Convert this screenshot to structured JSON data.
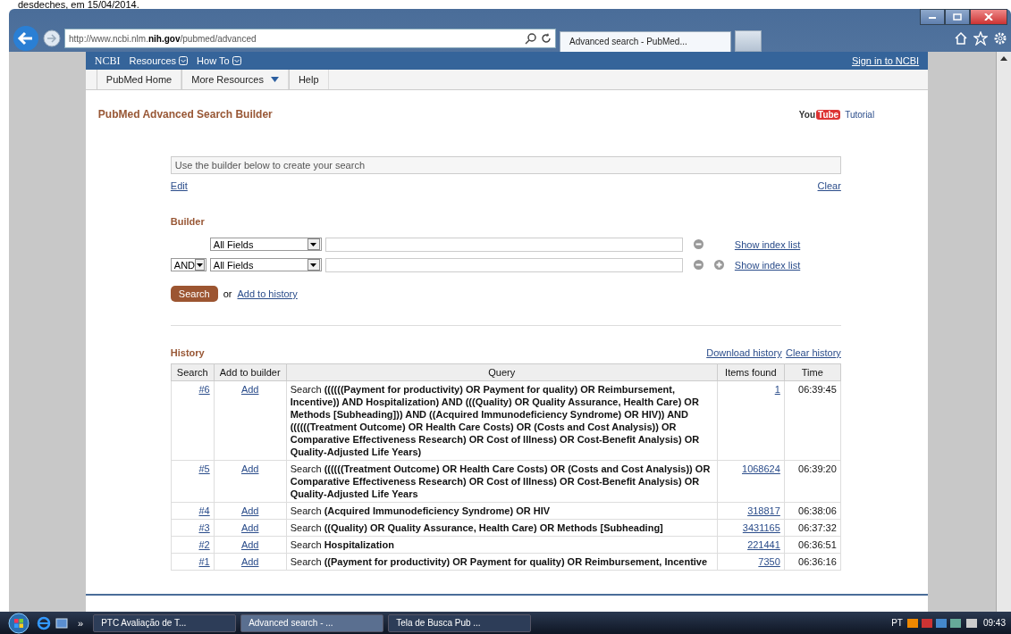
{
  "doc_caption": "desdeches, em 15/04/2014.",
  "browser": {
    "address_prefix": "http://www.ncbi.nlm.",
    "address_host": "nih.gov",
    "address_path": "/pubmed/advanced",
    "tabs": [
      {
        "title": "Advanced search - PubMed..."
      }
    ]
  },
  "ncbi_bar": {
    "logo": "NCBI",
    "menus": [
      "Resources",
      "How To"
    ],
    "sign_in": "Sign in to NCBI"
  },
  "nav": [
    {
      "label": "PubMed Home",
      "dropdown": false
    },
    {
      "label": "More Resources",
      "dropdown": true
    },
    {
      "label": "Help",
      "dropdown": false
    }
  ],
  "title": "PubMed Advanced Search Builder",
  "tutorial": {
    "logo_you": "You",
    "logo_tube": "Tube",
    "label": "Tutorial"
  },
  "search_box": {
    "placeholder": "Use the builder below to create your search"
  },
  "edit": "Edit",
  "clear": "Clear",
  "builder": {
    "heading": "Builder",
    "rows": [
      {
        "field": "All Fields",
        "can_add": false,
        "index_link": "Show index list"
      },
      {
        "operator": "AND",
        "field": "All Fields",
        "can_add": true,
        "index_link": "Show index list"
      }
    ]
  },
  "search_button": "Search",
  "or_text": "or",
  "add_to_history": "Add to history",
  "history": {
    "heading": "History",
    "download": "Download history",
    "clear": "Clear history",
    "columns": [
      "Search",
      "Add to builder",
      "Query",
      "Items found",
      "Time"
    ],
    "rows": [
      {
        "search": "#6",
        "add": "Add",
        "query": "Search **((((((Payment for productivity) OR Payment for quality) OR Reimbursement, Incentive)) AND Hospitalization) AND (((Quality) OR Quality Assurance, Health Care) OR Methods [Subheading])) AND ((Acquired Immunodeficiency Syndrome) OR HIV)) AND ((((((Treatment Outcome) OR Health Care Costs) OR (Costs and Cost Analysis)) OR Comparative Effectiveness Research) OR Cost of Illness) OR Cost-Benefit Analysis) OR Quality-Adjusted Life Years)**",
        "items": "1",
        "time": "06:39:45"
      },
      {
        "search": "#5",
        "add": "Add",
        "query": "Search **((((((Treatment Outcome) OR Health Care Costs) OR (Costs and Cost Analysis)) OR Comparative Effectiveness Research) OR Cost of Illness) OR Cost-Benefit Analysis) OR Quality-Adjusted Life Years**",
        "items": "1068624",
        "time": "06:39:20"
      },
      {
        "search": "#4",
        "add": "Add",
        "query": "Search **(Acquired Immunodeficiency Syndrome) OR HIV**",
        "items": "318817",
        "time": "06:38:06"
      },
      {
        "search": "#3",
        "add": "Add",
        "query": "Search **((Quality) OR Quality Assurance, Health Care) OR Methods [Subheading]**",
        "items": "3431165",
        "time": "06:37:32"
      },
      {
        "search": "#2",
        "add": "Add",
        "query": "Search **Hospitalization**",
        "items": "221441",
        "time": "06:36:51"
      },
      {
        "search": "#1",
        "add": "Add",
        "query": "Search **((Payment for productivity) OR Payment for quality) OR Reimbursement, Incentive**",
        "items": "7350",
        "time": "06:36:16"
      }
    ]
  },
  "taskbar": {
    "chevron": "»",
    "items": [
      {
        "label": "PTC Avaliação de T...",
        "selected": false
      },
      {
        "label": "Advanced search - ...",
        "selected": true
      },
      {
        "label": "Tela de Busca Pub ...",
        "selected": false
      }
    ],
    "language": "PT",
    "time": "09:43"
  }
}
